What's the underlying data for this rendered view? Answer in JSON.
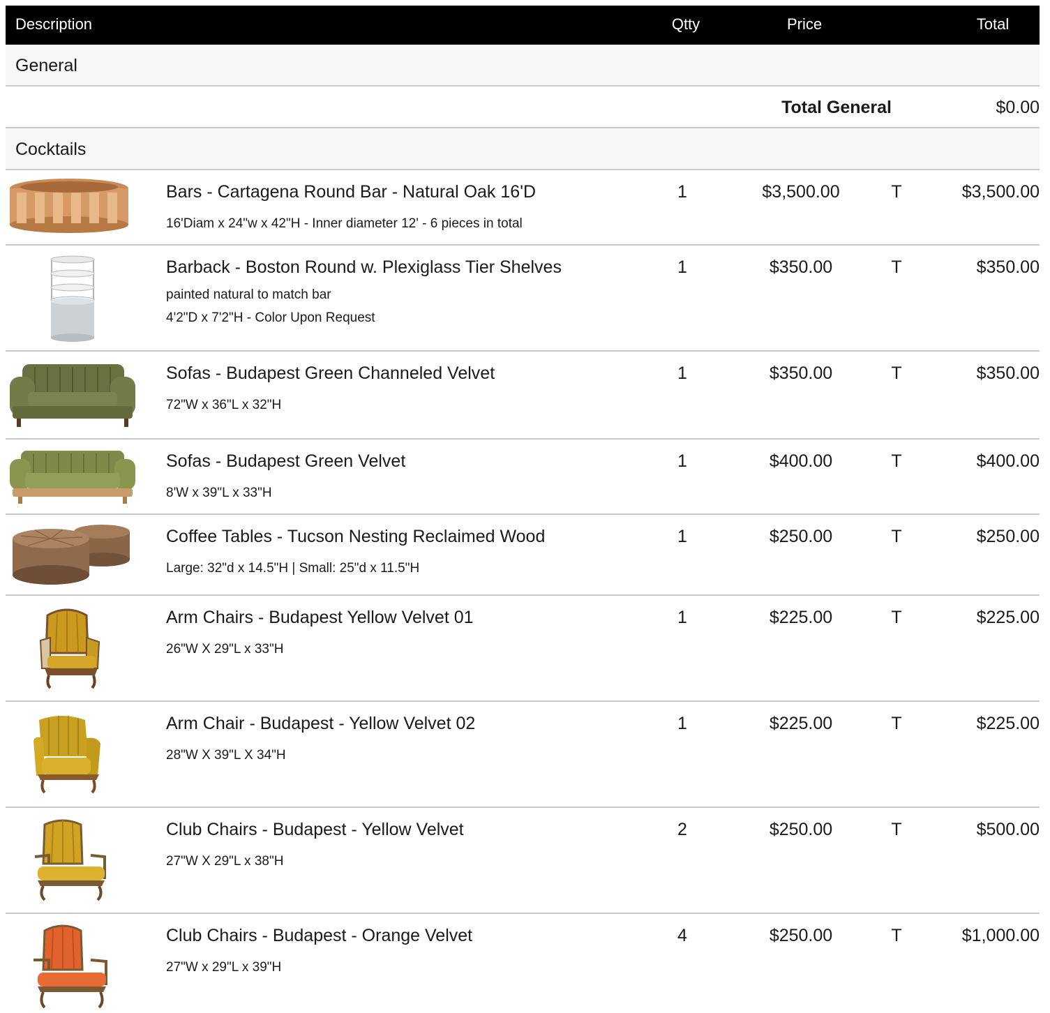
{
  "header": {
    "description": "Description",
    "qty": "Qtty",
    "price": "Price",
    "total": "Total"
  },
  "sections": [
    {
      "title": "General",
      "subtotal_label": "Total General",
      "subtotal_value": "$0.00"
    },
    {
      "title": "Cocktails"
    }
  ],
  "items": [
    {
      "image": "round-bar-image",
      "name": "Bars - Cartagena Round Bar - Natural Oak 16'D",
      "details": [
        "16'Diam x 24\"w x 42\"H - Inner diameter 12' - 6 pieces in total"
      ],
      "qty": "1",
      "price": "$3,500.00",
      "tax": "T",
      "total": "$3,500.00"
    },
    {
      "image": "barback-shelves-image",
      "name": "Barback - Boston Round w. Plexiglass Tier Shelves",
      "details": [
        "painted natural to match bar",
        "4'2\"D x 7'2\"H - Color Upon Request"
      ],
      "qty": "1",
      "price": "$350.00",
      "tax": "T",
      "total": "$350.00"
    },
    {
      "image": "green-sofa-image",
      "name": "Sofas - Budapest Green Channeled Velvet",
      "details": [
        "72\"W x 36\"L x 32\"H"
      ],
      "qty": "1",
      "price": "$350.00",
      "tax": "T",
      "total": "$350.00"
    },
    {
      "image": "green-velvet-sofa-image",
      "name": "Sofas - Budapest Green Velvet",
      "details": [
        "8'W x 39\"L x 33\"H"
      ],
      "qty": "1",
      "price": "$400.00",
      "tax": "T",
      "total": "$400.00"
    },
    {
      "image": "coffee-tables-image",
      "name": "Coffee Tables - Tucson Nesting Reclaimed Wood",
      "details": [
        "Large: 32\"d x 14.5\"H | Small: 25\"d x 11.5\"H"
      ],
      "qty": "1",
      "price": "$250.00",
      "tax": "T",
      "total": "$250.00"
    },
    {
      "image": "yellow-arm-chair-image",
      "name": "Arm Chairs - Budapest Yellow Velvet 01",
      "details": [
        "26\"W X 29\"L x 33\"H"
      ],
      "qty": "1",
      "price": "$225.00",
      "tax": "T",
      "total": "$225.00"
    },
    {
      "image": "yellow-arm-chair-2-image",
      "name": "Arm Chair - Budapest - Yellow Velvet 02",
      "details": [
        "28\"W X 39\"L X 34\"H"
      ],
      "qty": "1",
      "price": "$225.00",
      "tax": "T",
      "total": "$225.00"
    },
    {
      "image": "yellow-club-chair-image",
      "name": "Club Chairs - Budapest - Yellow Velvet",
      "details": [
        "27\"W X 29\"L x 38\"H"
      ],
      "qty": "2",
      "price": "$250.00",
      "tax": "T",
      "total": "$500.00"
    },
    {
      "image": "orange-club-chair-image",
      "name": "Club Chairs - Budapest - Orange Velvet",
      "details": [
        "27\"W x 29\"L x 39\"H"
      ],
      "qty": "4",
      "price": "$250.00",
      "tax": "T",
      "total": "$1,000.00"
    }
  ],
  "colors": {
    "header_bg": "#000000",
    "section_bg": "#f6f7f9",
    "divider": "#c8c9cc"
  }
}
